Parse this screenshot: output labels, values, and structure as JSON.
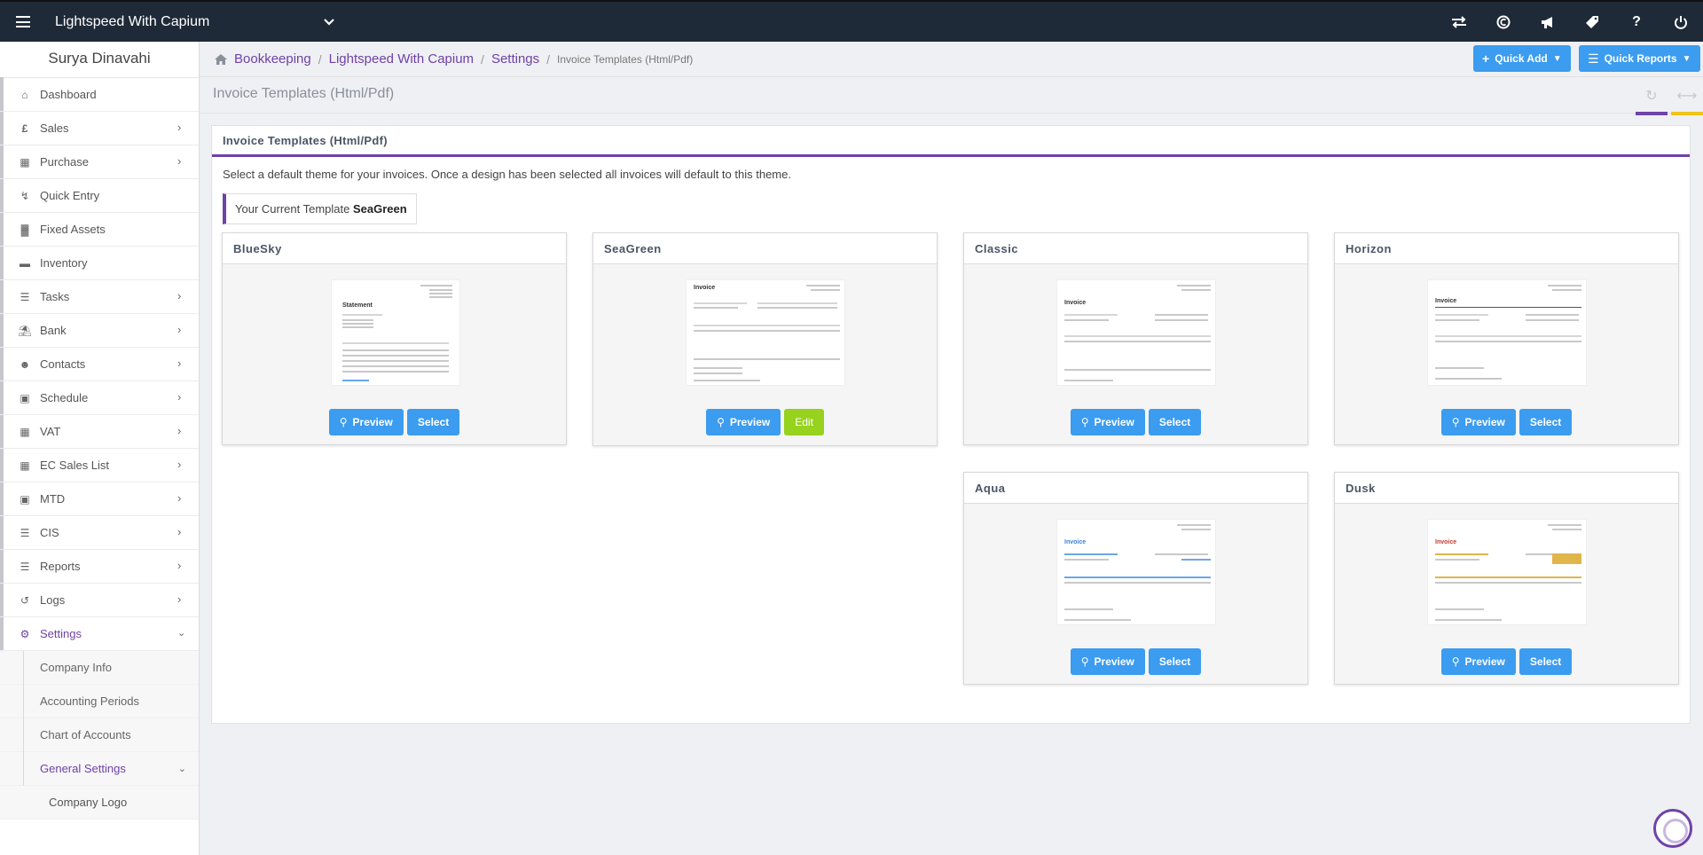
{
  "topbar": {
    "company": "Lightspeed With Capium",
    "icons": [
      "swap-icon",
      "currency-icon",
      "megaphone-icon",
      "tag-icon",
      "help-icon",
      "power-icon"
    ]
  },
  "sidebar": {
    "user": "Surya Dinavahi",
    "items": [
      {
        "label": "Dashboard",
        "icon": "home-icon",
        "chevron": false
      },
      {
        "label": "Sales",
        "icon": "pound-icon",
        "chevron": true
      },
      {
        "label": "Purchase",
        "icon": "purchase-icon",
        "chevron": true
      },
      {
        "label": "Quick Entry",
        "icon": "bolt-icon",
        "chevron": false
      },
      {
        "label": "Fixed Assets",
        "icon": "building-icon",
        "chevron": false
      },
      {
        "label": "Inventory",
        "icon": "truck-icon",
        "chevron": false
      },
      {
        "label": "Tasks",
        "icon": "tasks-icon",
        "chevron": true
      },
      {
        "label": "Bank",
        "icon": "bank-icon",
        "chevron": true
      },
      {
        "label": "Contacts",
        "icon": "users-icon",
        "chevron": true
      },
      {
        "label": "Schedule",
        "icon": "calendar-icon",
        "chevron": true
      },
      {
        "label": "VAT",
        "icon": "calculator-icon",
        "chevron": true
      },
      {
        "label": "EC Sales List",
        "icon": "calculator-icon",
        "chevron": true
      },
      {
        "label": "MTD",
        "icon": "calendar-icon",
        "chevron": true
      },
      {
        "label": "CIS",
        "icon": "list-icon",
        "chevron": true
      },
      {
        "label": "Reports",
        "icon": "reports-icon",
        "chevron": true
      },
      {
        "label": "Logs",
        "icon": "history-icon",
        "chevron": true
      },
      {
        "label": "Settings",
        "icon": "cogs-icon",
        "chevron": true
      }
    ],
    "settings_sub": [
      "Company Info",
      "Accounting Periods",
      "Chart of Accounts",
      "General Settings"
    ],
    "general_sub": [
      "Company Logo"
    ]
  },
  "breadcrumb": {
    "items": [
      "Bookkeeping",
      "Lightspeed With Capium",
      "Settings"
    ],
    "current": "Invoice Templates (Html/Pdf)"
  },
  "quick": {
    "add": "Quick Add",
    "reports": "Quick Reports"
  },
  "page": {
    "title": "Invoice Templates (Html/Pdf)",
    "panel_title": "Invoice Templates (Html/Pdf)",
    "description": "Select a default theme for your invoices. Once a design has been selected all invoices will default to this theme.",
    "current_label": "Your Current Template",
    "current_value": "SeaGreen"
  },
  "templates": [
    {
      "name": "BlueSky",
      "preview": "Preview",
      "action": "Select",
      "accent": "#c9c9c9"
    },
    {
      "name": "SeaGreen",
      "preview": "Preview",
      "action": "Edit",
      "accent": "#c9c9c9"
    },
    {
      "name": "Classic",
      "preview": "Preview",
      "action": "Select",
      "accent": "#c9c9c9"
    },
    {
      "name": "Horizon",
      "preview": "Preview",
      "action": "Select",
      "accent": "#c9c9c9"
    },
    {
      "name": "Aqua",
      "preview": "Preview",
      "action": "Select",
      "accent": "#6aa7e8"
    },
    {
      "name": "Dusk",
      "preview": "Preview",
      "action": "Select",
      "accent": "#e0b64a"
    }
  ],
  "colors": {
    "topbar": "#1f2a38",
    "accent": "#6f42a8",
    "button": "#3b9cf0",
    "edit": "#96d21e"
  }
}
